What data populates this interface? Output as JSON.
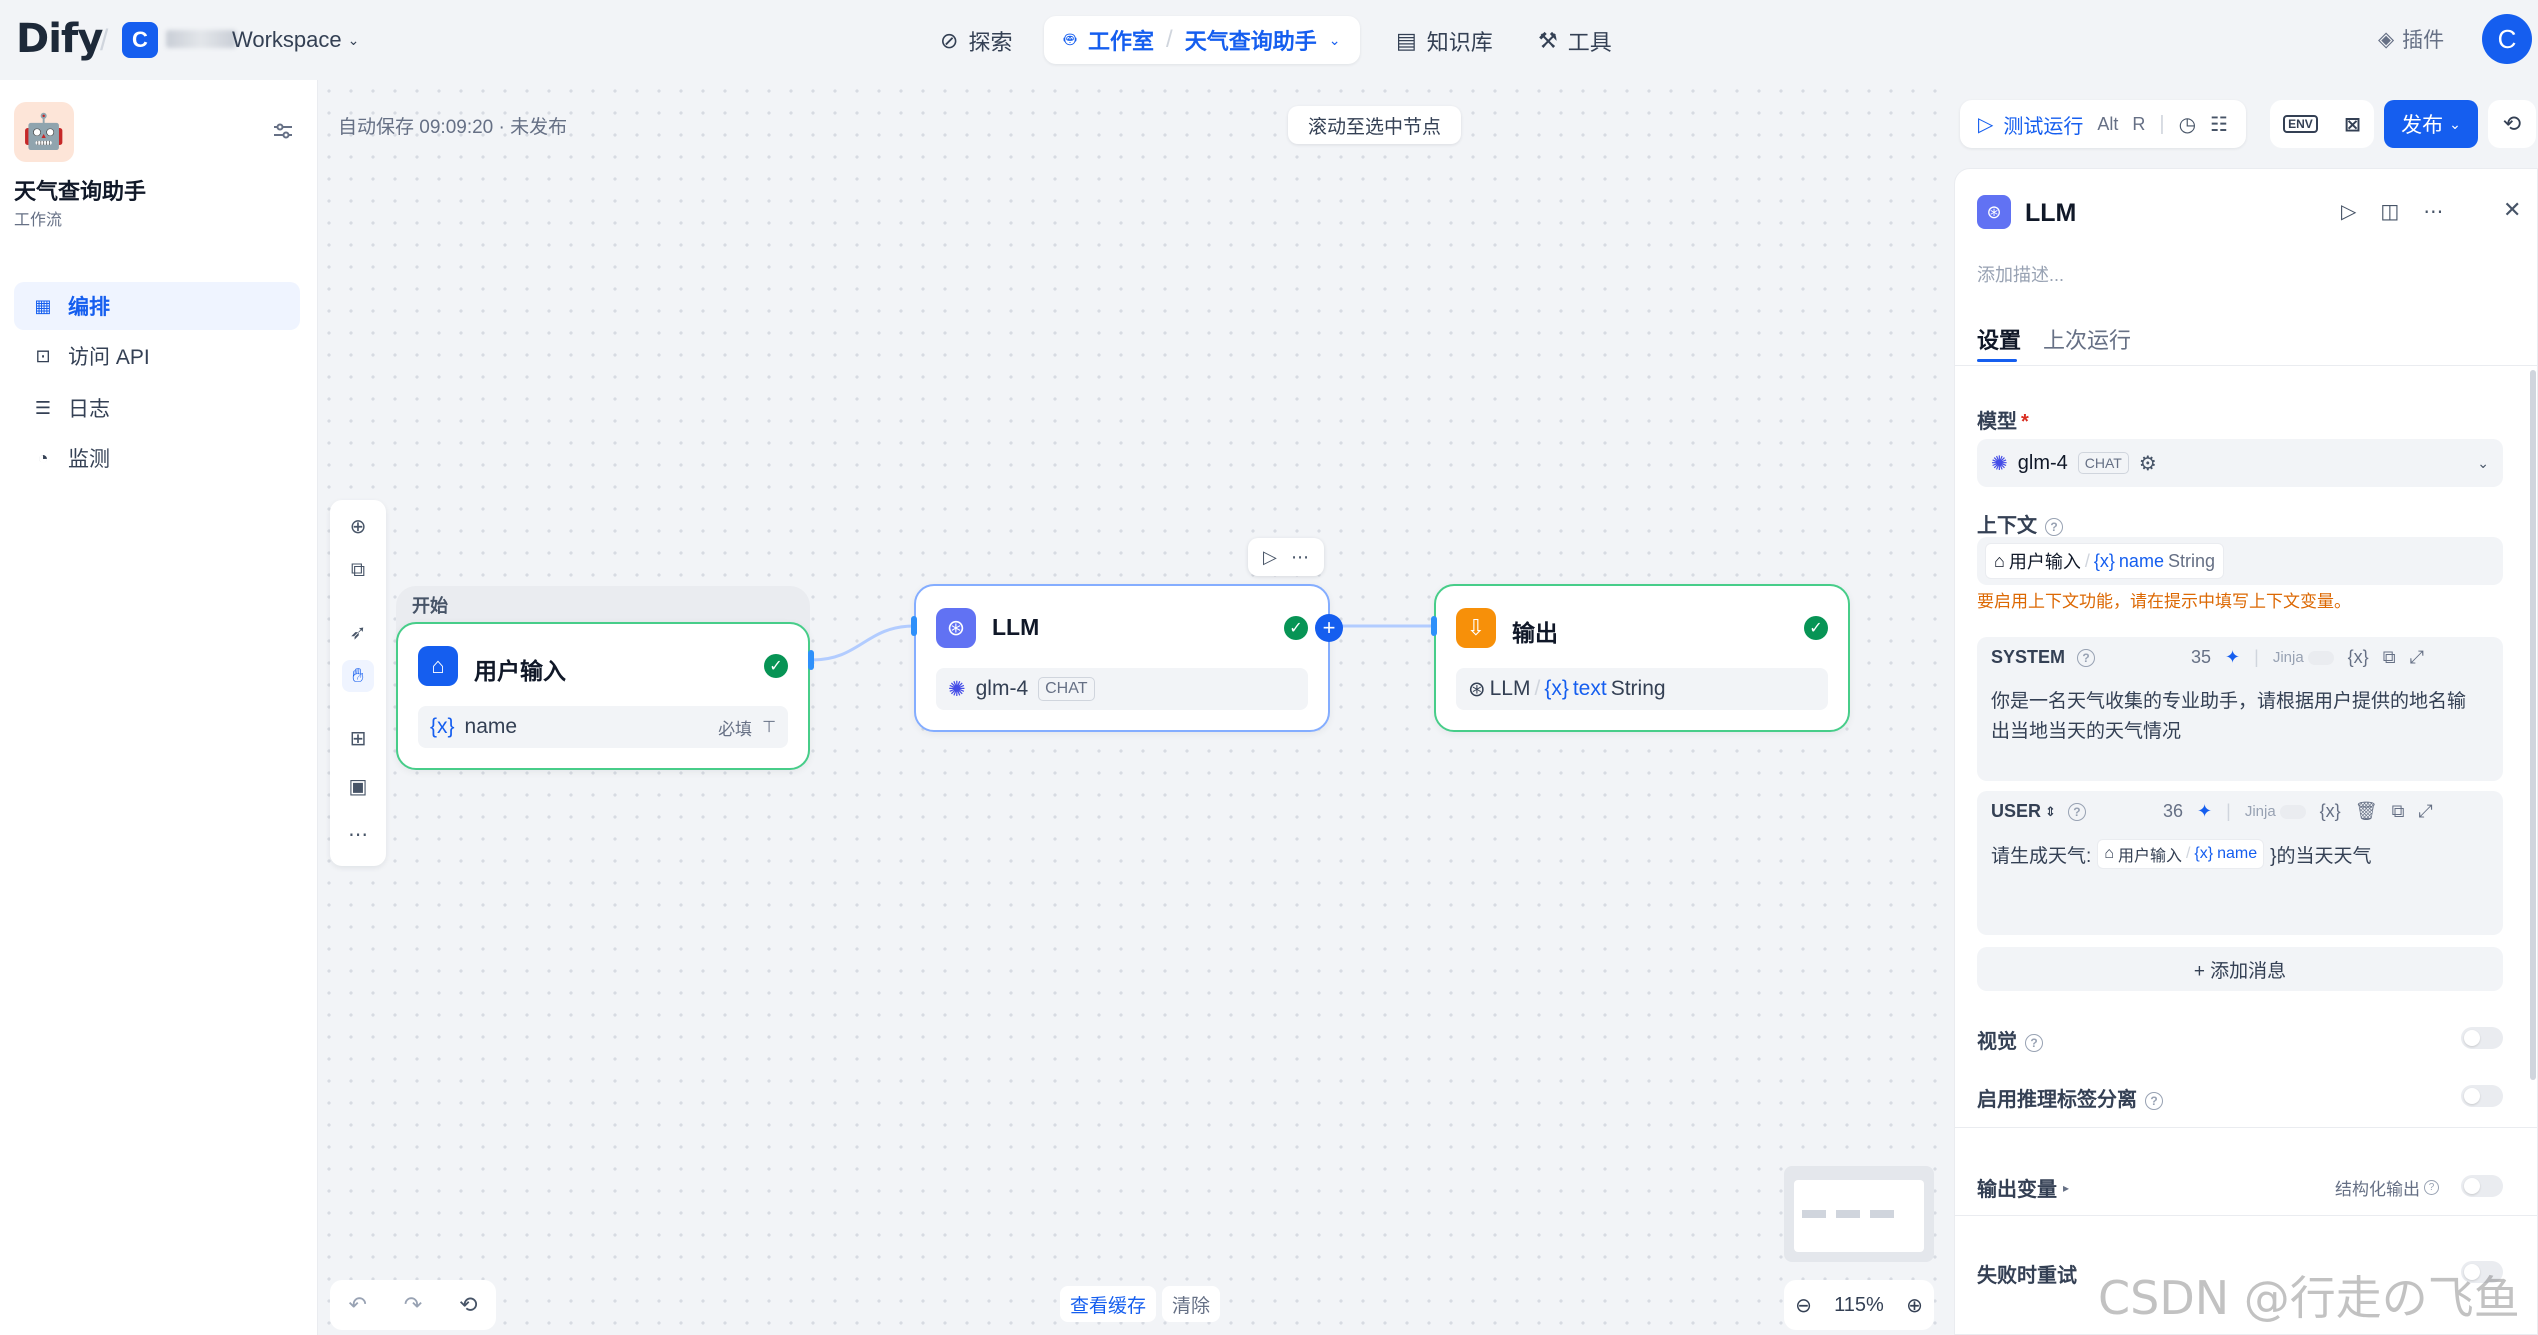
{
  "topbar": {
    "logo": "Dify",
    "workspace_initial": "C",
    "workspace_name": "Workspace",
    "nav": {
      "explore": "探索",
      "studio": "工作室",
      "app_switch": "天气查询助手",
      "knowledge": "知识库",
      "tools": "工具"
    },
    "plugins": "插件",
    "avatar_initial": "C"
  },
  "sidebar": {
    "app_name": "天气查询助手",
    "app_type": "工作流",
    "items": [
      {
        "label": "编排",
        "icon": "layout-icon",
        "active": true
      },
      {
        "label": "访问 API",
        "icon": "terminal-icon",
        "active": false
      },
      {
        "label": "日志",
        "icon": "file-list-icon",
        "active": false
      },
      {
        "label": "监测",
        "icon": "dashboard-icon",
        "active": false
      }
    ]
  },
  "canvas": {
    "autosave": "自动保存 09:09:20 · 未发布",
    "scroll_to_node": "滚动至选中节点",
    "bottom": {
      "view_cache": "查看缓存",
      "clear": "清除"
    },
    "zoom": "115%"
  },
  "nodes": {
    "start": {
      "group_label": "开始",
      "title": "用户输入",
      "var": "name",
      "required": "必填"
    },
    "llm": {
      "title": "LLM",
      "model": "glm-4",
      "mode": "CHAT"
    },
    "output": {
      "title": "输出",
      "src": "LLM",
      "var": "text",
      "type": "String"
    }
  },
  "run_bar": {
    "test_run": "测试运行",
    "shortcut1": "Alt",
    "shortcut2": "R",
    "env": "ENV",
    "publish": "发布"
  },
  "panel": {
    "title": "LLM",
    "desc_placeholder": "添加描述...",
    "tabs": [
      "设置",
      "上次运行"
    ],
    "model_label": "模型",
    "model_name": "glm-4",
    "model_mode": "CHAT",
    "context_label": "上下文",
    "context_src": "用户输入",
    "context_var": "name",
    "context_type": "String",
    "context_warning": "要启用上下文功能，请在提示中填写上下文变量。",
    "system": {
      "role": "SYSTEM",
      "count": "35",
      "jinja": "Jinja",
      "text": "你是一名天气收集的专业助手，请根据用户提供的地名输出当地当天的天气情况"
    },
    "user": {
      "role": "USER",
      "count": "36",
      "jinja": "Jinja",
      "prefix": "请生成天气:",
      "src": "用户输入",
      "var": "name",
      "suffix": "}的当天天气"
    },
    "add_message": "+ 添加消息",
    "vision": "视觉",
    "reasoning": "启用推理标签分离",
    "output_vars": "输出变量",
    "structured_output": "结构化输出",
    "retry": "失败时重试"
  },
  "watermark": "CSDN @行走の飞鱼",
  "colors": {
    "primary": "#155eef",
    "success": "#079455",
    "warning": "#dc6803"
  }
}
